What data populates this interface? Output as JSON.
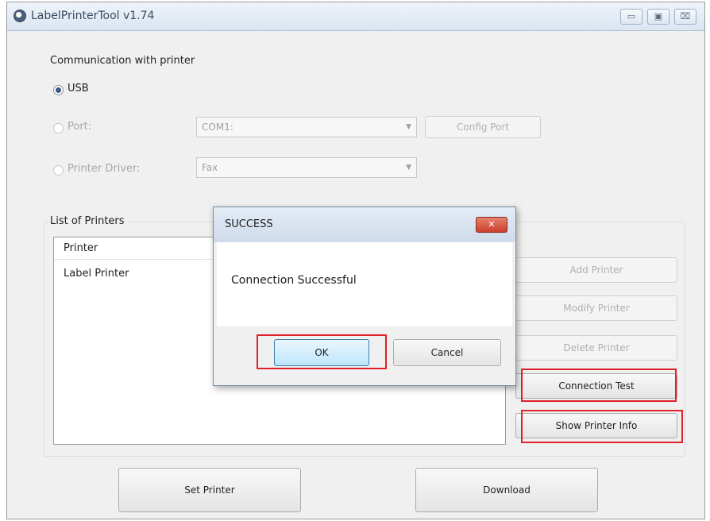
{
  "window": {
    "title": "LabelPrinterTool v1.74",
    "buttons": {
      "minimize": "▭",
      "maximize": "▣",
      "close": "⌧"
    }
  },
  "communication": {
    "heading": "Communication with printer",
    "usb_label": "USB",
    "port_label": "Port:",
    "port_value": "COM1:",
    "config_port_label": "Config Port",
    "driver_label": "Printer Driver:",
    "driver_value": "Fax"
  },
  "printers": {
    "heading": "List of Printers",
    "column_header": "Printer",
    "items": [
      "Label Printer"
    ]
  },
  "side_buttons": {
    "add": "Add Printer",
    "modify": "Modify Printer",
    "delete": "Delete Printer",
    "connection_test": "Connection Test",
    "show_info": "Show Printer Info"
  },
  "bottom_buttons": {
    "set_printer": "Set Printer",
    "download": "Download"
  },
  "dialog": {
    "title": "SUCCESS",
    "message": "Connection Successful",
    "ok_label": "OK",
    "cancel_label": "Cancel",
    "close_glyph": "✕"
  },
  "icons": {
    "app": "app-icon",
    "dropdown": "chevron-down-icon",
    "dropdown_glyph": "▼"
  },
  "colors": {
    "highlight": "#e0202a",
    "titlebar": "#dbe5f1",
    "dialog_close": "#c8402a"
  }
}
